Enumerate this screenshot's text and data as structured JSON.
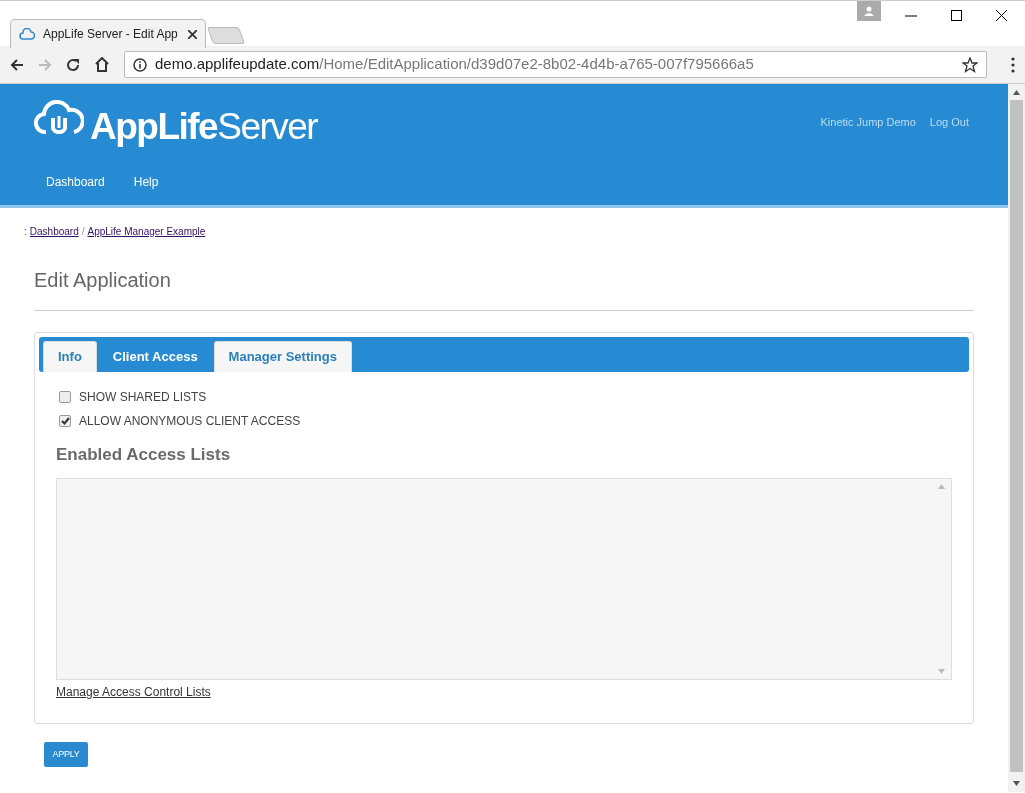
{
  "browser": {
    "tab_title": "AppLife Server - Edit App",
    "url_host": "demo.applifeupdate.com",
    "url_path": "/Home/EditApplication/d39d07e2-8b02-4d4b-a765-007f795666a5"
  },
  "header": {
    "logo": "**AppLife**Server",
    "user_links": [
      "Kinetic Jump Demo",
      "Log Out"
    ],
    "nav": [
      "Dashboard",
      "Help"
    ]
  },
  "breadcrumb": {
    "prefix": ":",
    "items": [
      "Dashboard",
      "AppLife Manager Example"
    ],
    "separator": "/"
  },
  "page_title": "Edit Application",
  "tabs": [
    {
      "label": "Info",
      "selected": false
    },
    {
      "label": "Client Access",
      "selected": true
    },
    {
      "label": "Manager Settings",
      "selected": false
    }
  ],
  "options": [
    {
      "label": "SHOW SHARED LISTS",
      "checked": false
    },
    {
      "label": "ALLOW ANONYMOUS CLIENT ACCESS",
      "checked": true
    }
  ],
  "section_title": "Enabled Access Lists",
  "manage_link": "Manage Access Control Lists",
  "apply_button": "APPLY"
}
